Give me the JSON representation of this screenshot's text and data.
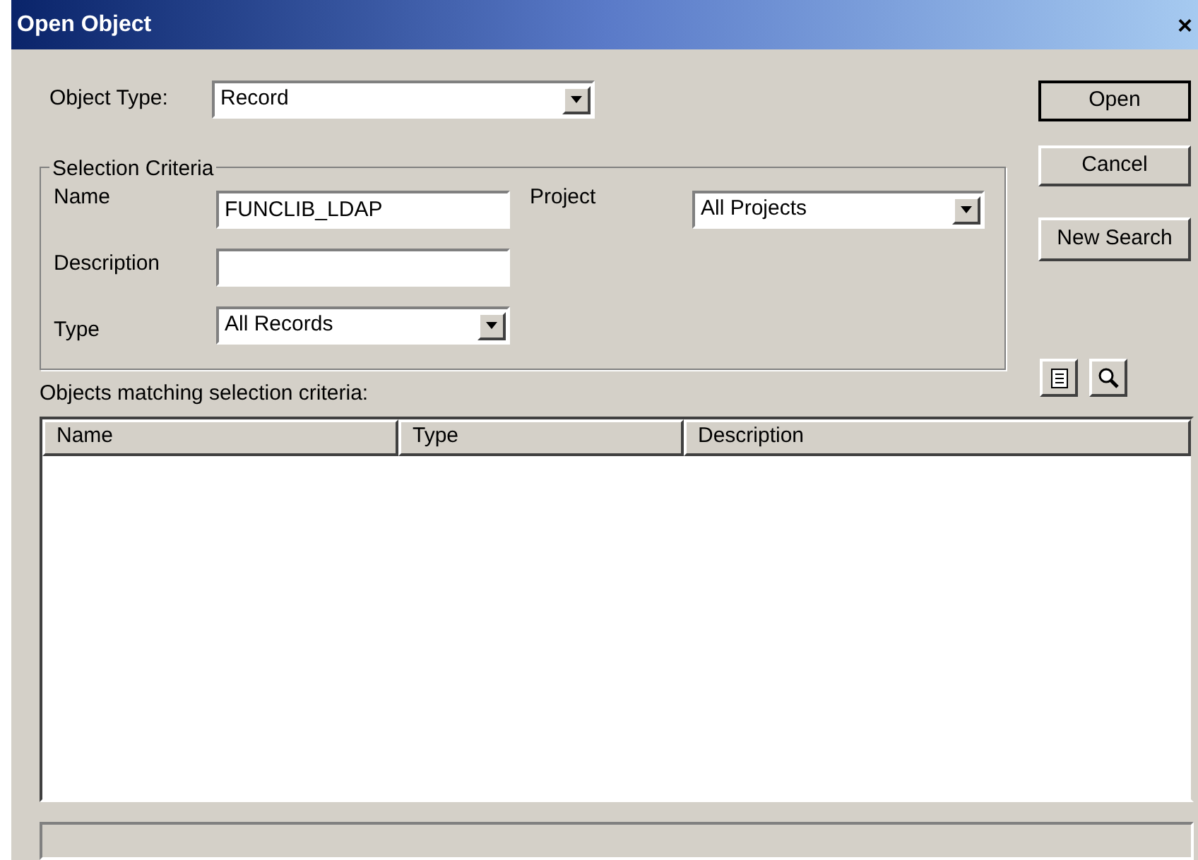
{
  "window": {
    "title": "Open Object",
    "close": "×"
  },
  "object_type": {
    "label": "Object Type:",
    "value": "Record"
  },
  "selection_criteria": {
    "title": "Selection Criteria",
    "name": {
      "label": "Name",
      "value": "FUNCLIB_LDAP"
    },
    "description": {
      "label": "Description"
    },
    "type": {
      "label": "Type",
      "value": "All Records"
    },
    "project": {
      "label": "Project",
      "value": "All Projects"
    }
  },
  "buttons": [
    "Open",
    "Cancel",
    "New Search"
  ],
  "results": {
    "label": "Objects matching selection criteria:",
    "columns": [
      "Name",
      "Type",
      "Description"
    ]
  }
}
